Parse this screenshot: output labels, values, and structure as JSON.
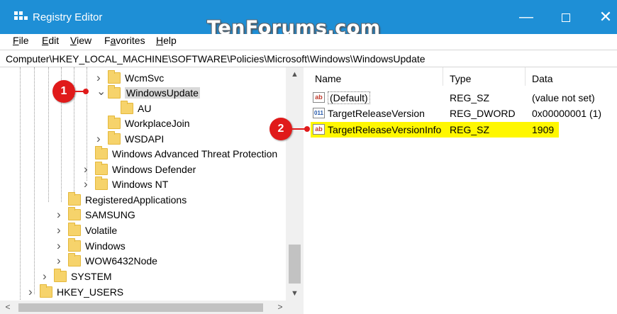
{
  "window": {
    "title": "Registry Editor",
    "watermark": "TenForums.com",
    "controls": {
      "minimize": "—",
      "close": "✕"
    }
  },
  "menu": [
    "File",
    "Edit",
    "View",
    "Favorites",
    "Help"
  ],
  "menu_underline": [
    "F",
    "E",
    "V",
    "a",
    "H"
  ],
  "address": "Computer\\HKEY_LOCAL_MACHINE\\SOFTWARE\\Policies\\Microsoft\\Windows\\WindowsUpdate",
  "tree": [
    {
      "label": "WcmSvc",
      "expander": "collapsed"
    },
    {
      "label": "WindowsUpdate",
      "expander": "expanded",
      "selected": true
    },
    {
      "label": "AU",
      "expander": "none"
    },
    {
      "label": "WorkplaceJoin",
      "expander": "none"
    },
    {
      "label": "WSDAPI",
      "expander": "collapsed"
    },
    {
      "label": "Windows Advanced Threat Protection",
      "expander": "none"
    },
    {
      "label": "Windows Defender",
      "expander": "collapsed"
    },
    {
      "label": "Windows NT",
      "expander": "collapsed"
    },
    {
      "label": "RegisteredApplications",
      "expander": "none"
    },
    {
      "label": "SAMSUNG",
      "expander": "collapsed"
    },
    {
      "label": "Volatile",
      "expander": "collapsed"
    },
    {
      "label": "Windows",
      "expander": "collapsed"
    },
    {
      "label": "WOW6432Node",
      "expander": "collapsed"
    },
    {
      "label": "SYSTEM",
      "expander": "collapsed"
    },
    {
      "label": "HKEY_USERS",
      "expander": "collapsed"
    }
  ],
  "list": {
    "headers": {
      "name": "Name",
      "type": "Type",
      "data": "Data"
    },
    "rows": [
      {
        "icon": "ab",
        "name": "(Default)",
        "type": "REG_SZ",
        "data": "(value not set)"
      },
      {
        "icon": "011",
        "name": "TargetReleaseVersion",
        "type": "REG_DWORD",
        "data": "0x00000001 (1)"
      },
      {
        "icon": "ab",
        "name": "TargetReleaseVersionInfo",
        "type": "REG_SZ",
        "data": "1909",
        "highlighted": true
      }
    ]
  },
  "callouts": [
    "1",
    "2"
  ],
  "colors": {
    "titlebar": "#1e8fd6",
    "highlight": "#fff700",
    "callout": "#e01a1a",
    "folder": "#f6d36b"
  }
}
